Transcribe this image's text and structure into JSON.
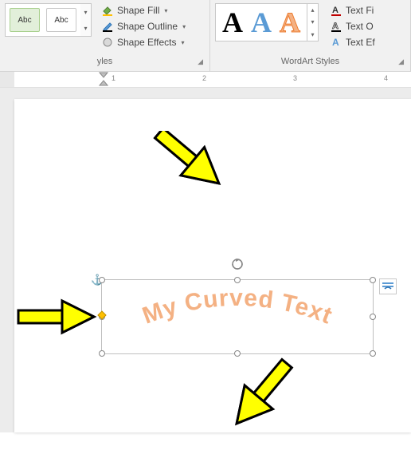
{
  "ribbon": {
    "shape_styles": {
      "label": "yles",
      "sample_text": "Abc",
      "fill": "Shape Fill",
      "outline": "Shape Outline",
      "effects": "Shape Effects"
    },
    "wordart_styles": {
      "label": "WordArt Styles",
      "sample": "A",
      "text_fill": "Text Fi",
      "text_outline": "Text O",
      "text_effects": "Text Ef"
    }
  },
  "ruler": {
    "numbers": [
      "1",
      "2",
      "3",
      "4"
    ]
  },
  "textbox": {
    "content": "My Curved Text"
  }
}
